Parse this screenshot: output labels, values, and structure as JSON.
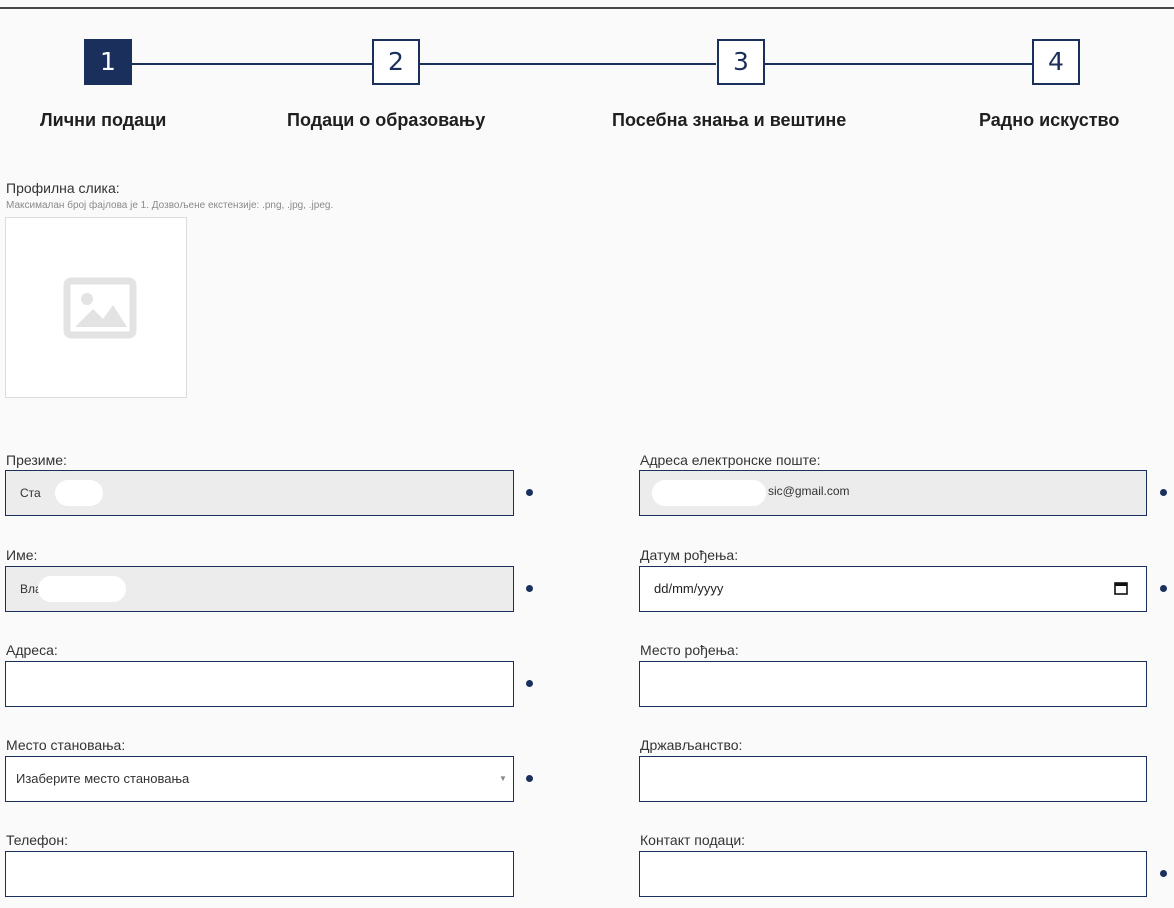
{
  "stepper": {
    "steps": [
      {
        "number": "1",
        "label": "Лични подаци",
        "active": true
      },
      {
        "number": "2",
        "label": "Подаци о образовању",
        "active": false
      },
      {
        "number": "3",
        "label": "Посебна знања и вештине",
        "active": false
      },
      {
        "number": "4",
        "label": "Радно искуство",
        "active": false
      }
    ]
  },
  "profile_picture": {
    "label": "Профилна слика:",
    "hint": "Максималан број фајлова је 1. Дозвољене екстензије: .png, .jpg, .jpeg.",
    "icon": "image-placeholder-icon"
  },
  "form": {
    "surname": {
      "label": "Презиме:",
      "value": "Ста",
      "required": true
    },
    "first_name": {
      "label": "Име:",
      "value": "Вла",
      "required": true
    },
    "address": {
      "label": "Адреса:",
      "value": "",
      "required": true
    },
    "residence": {
      "label": "Место становања:",
      "placeholder": "Изаберите место становања",
      "required": true
    },
    "phone": {
      "label": "Телефон:",
      "value": ""
    },
    "email": {
      "label": "Адреса електронске поште:",
      "value": "sic@gmail.com",
      "required": true
    },
    "birth_date": {
      "label": "Датум рођења:",
      "placeholder": "dd/mm/yyyy",
      "required": true
    },
    "birth_place": {
      "label": "Место рођења:",
      "value": ""
    },
    "citizenship": {
      "label": "Држављанство:",
      "value": ""
    },
    "contact": {
      "label": "Контакт подаци:",
      "value": "",
      "required": true
    }
  },
  "colors": {
    "accent": "#1b2f5c",
    "readonly_bg": "#ececec",
    "page_bg": "#fafafa"
  }
}
